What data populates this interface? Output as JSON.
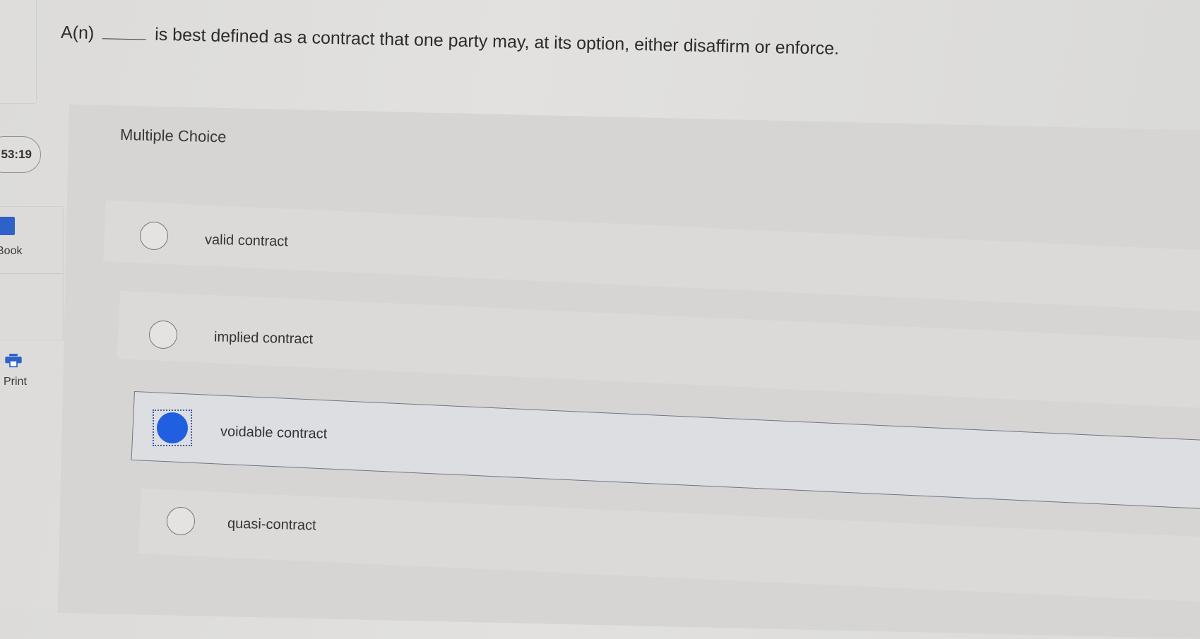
{
  "sidebar": {
    "timer": ":53:19",
    "tools": [
      {
        "label": "Book",
        "icon": "book-icon"
      },
      {
        "label": "Print",
        "icon": "printer-icon"
      }
    ]
  },
  "question": {
    "prefix": "A(n)",
    "suffix": "is best defined as a contract that one party may, at its option, either disaffirm or enforce."
  },
  "multiple_choice": {
    "title": "Multiple Choice",
    "options": [
      {
        "label": "valid contract",
        "selected": false
      },
      {
        "label": "implied contract",
        "selected": false
      },
      {
        "label": "voidable contract",
        "selected": true
      },
      {
        "label": "quasi-contract",
        "selected": false
      }
    ]
  },
  "colors": {
    "selected_radio": "#1f5fe0",
    "book_icon": "#2e62c8"
  }
}
